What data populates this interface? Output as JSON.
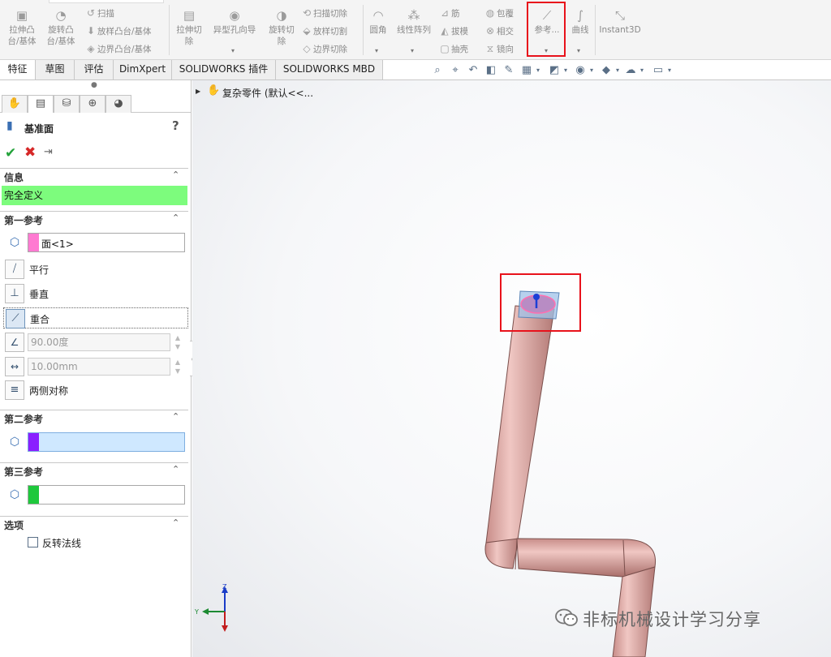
{
  "ribbon": {
    "extrude_boss_line1": "拉伸凸",
    "extrude_boss_line2": "台/基体",
    "revolve_boss_line1": "旋转凸",
    "revolve_boss_line2": "台/基体",
    "sweep": "扫描",
    "loft_boss": "放样凸台/基体",
    "boundary_boss": "边界凸台/基体",
    "extrude_cut_line1": "拉伸切",
    "extrude_cut_line2": "除",
    "hole_wizard": "异型孔向导",
    "revolve_cut_line1": "旋转切",
    "revolve_cut_line2": "除",
    "sweep_cut": "扫描切除",
    "loft_cut": "放样切割",
    "boundary_cut": "边界切除",
    "fillet": "圆角",
    "linear_pattern": "线性阵列",
    "rib": "筋",
    "draft": "拔模",
    "shell": "抽壳",
    "wrap": "包覆",
    "intersect": "相交",
    "mirror": "镜向",
    "reference": "参考...",
    "curves": "曲线",
    "instant3d": "Instant3D",
    "highlight_color": "#e8121b"
  },
  "tabs": [
    {
      "label": "特征"
    },
    {
      "label": "草图"
    },
    {
      "label": "评估"
    },
    {
      "label": "DimXpert"
    },
    {
      "label": "SOLIDWORKS 插件"
    },
    {
      "label": "SOLIDWORKS MBD"
    }
  ],
  "tree": {
    "part_label": "复杂零件 (默认<<..."
  },
  "panel": {
    "title": "基准面",
    "help": "?",
    "info": {
      "heading": "信息",
      "status": "完全定义",
      "status_color": "#7dfc7d"
    },
    "first_ref": {
      "heading": "第一参考",
      "selection": "面<1>",
      "swatch_color": "#ff7ad1",
      "parallel": "平行",
      "perpendicular": "垂直",
      "coincident": "重合",
      "angle_value": "90.00度",
      "distance_value": "10.00mm",
      "mid_plane": "两侧对称"
    },
    "second_ref": {
      "heading": "第二参考",
      "selection": "",
      "swatch_color": "#8a1fff"
    },
    "third_ref": {
      "heading": "第三参考",
      "selection": "",
      "swatch_color": "#1ec83c"
    },
    "options": {
      "heading": "选项",
      "flip_normal": "反转法线"
    }
  },
  "model": {
    "tube_color": "#e7b4b0",
    "plane_color": "#9fc2e8"
  },
  "triad": {
    "z": "Z",
    "y": "Y"
  },
  "watermark": {
    "text": "非标机械设计学习分享"
  }
}
